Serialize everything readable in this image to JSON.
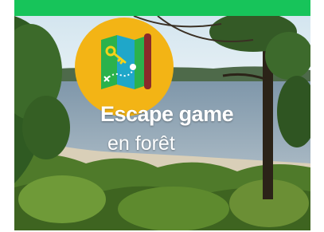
{
  "banner": {
    "title_line1": "Escape game",
    "title_line2": "en forêt",
    "logo_icon": "treasure-map-icon",
    "colors": {
      "top_bar": "#17c45a",
      "logo_circle": "#f3b415",
      "text": "#ffffff"
    }
  }
}
